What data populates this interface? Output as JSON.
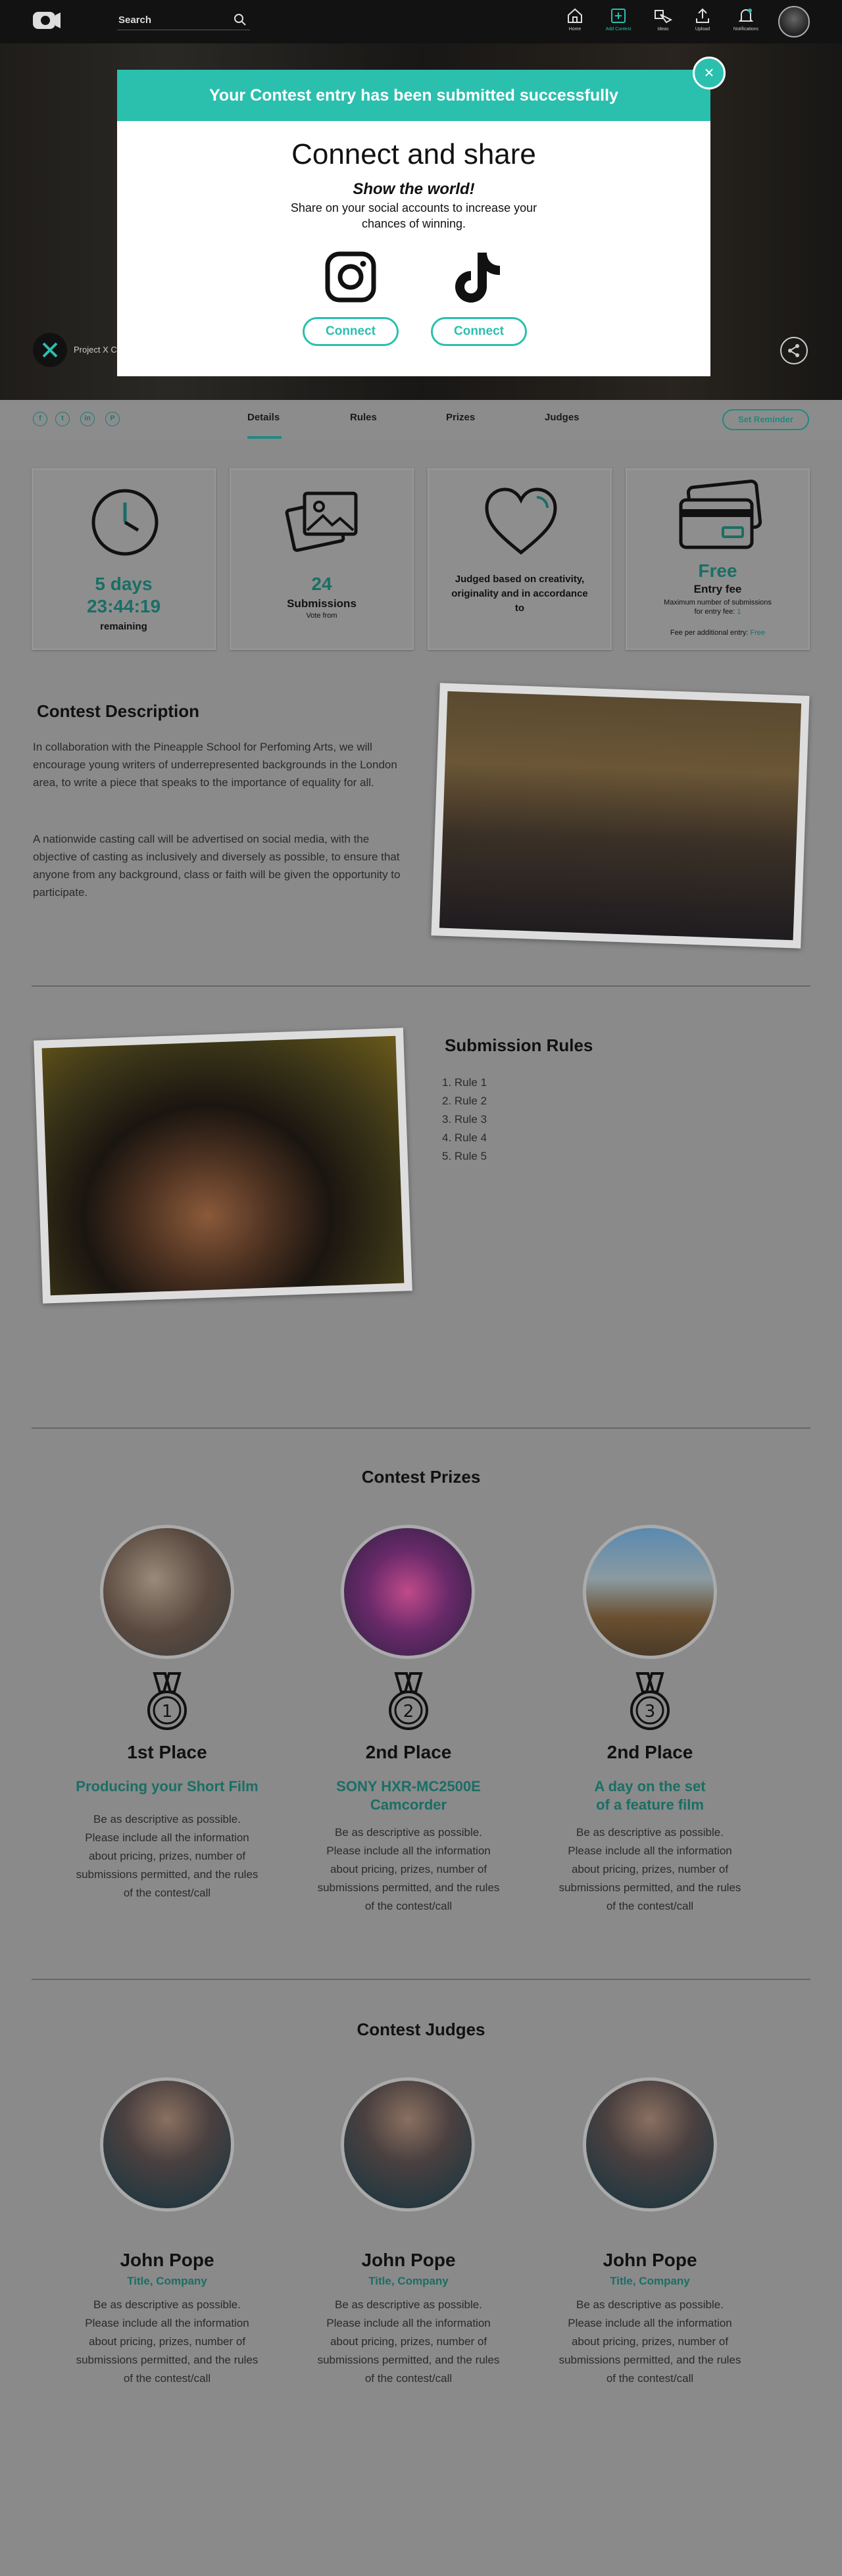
{
  "topbar": {
    "search_placeholder": "Search",
    "nav": [
      {
        "label": "Home",
        "icon": "home-icon"
      },
      {
        "label": "Add Contest",
        "icon": "add-contest-icon"
      },
      {
        "label": "Ideas",
        "icon": "ideas-icon"
      },
      {
        "label": "Upload",
        "icon": "upload-icon"
      },
      {
        "label": "Notifications",
        "icon": "bell-icon"
      }
    ]
  },
  "hero": {
    "caption": "Project X C"
  },
  "tabs": {
    "items": [
      "Details",
      "Rules",
      "Prizes",
      "Judges"
    ],
    "active": "Details",
    "reminder": "Set Reminder"
  },
  "social": [
    "f",
    "t",
    "in",
    "P"
  ],
  "stats": {
    "time": {
      "days": "5 days",
      "clock": "23:44:19",
      "label": "remaining"
    },
    "submissions": {
      "count": "24",
      "label": "Submissions",
      "sub": "Vote from"
    },
    "judged": {
      "text": "Judged based on creativity, originality and in accordance to"
    },
    "fee": {
      "value": "Free",
      "label": "Entry fee",
      "max_line1": "Maximum number of submissions",
      "max_line2": "for entry fee: ",
      "max_value": "1",
      "extra": "Fee per additional entry: ",
      "extra_value": "Free"
    }
  },
  "description": {
    "title": "Contest Description",
    "p1": "In collaboration with the Pineapple School for Perfoming Arts, we will encourage young writers of underrepresented backgrounds in the London area, to write a piece that speaks to the importance of equality for all.",
    "p2": "A nationwide casting call will be advertised on social media, with the objective of casting as inclusively and diversely as possible, to ensure that anyone from any background, class or faith will be given the opportunity to participate."
  },
  "rules": {
    "title": "Submission Rules",
    "items": [
      "Rule 1",
      "Rule 2",
      "Rule 3",
      "Rule 4",
      "Rule 5"
    ]
  },
  "prizes": {
    "title": "Contest Prizes",
    "items": [
      {
        "place": "1st Place",
        "medal": "1",
        "name_l1": "Producing your Short Film",
        "name_l2": "",
        "desc": "Be as descriptive as possible. Please include all the information about pricing, prizes, number of submissions permitted, and the rules of the contest/call"
      },
      {
        "place": "2nd Place",
        "medal": "2",
        "name_l1": "SONY HXR-MC2500E",
        "name_l2": "Camcorder",
        "desc": "Be as descriptive as possible. Please include all the information about pricing, prizes, number of submissions permitted, and the rules of the contest/call"
      },
      {
        "place": "2nd Place",
        "medal": "3",
        "name_l1": "A day on the set",
        "name_l2": "of a feature film",
        "desc": "Be as descriptive as possible. Please include all the information about pricing, prizes, number of submissions permitted, and the rules of the contest/call"
      }
    ]
  },
  "judges": {
    "title": "Contest Judges",
    "items": [
      {
        "name": "John Pope",
        "title": "Title, Company",
        "desc": "Be as descriptive as possible. Please include all the information about pricing, prizes, number of submissions permitted, and the rules of the contest/call"
      },
      {
        "name": "John Pope",
        "title": "Title, Company",
        "desc": "Be as descriptive as possible. Please include all the information about pricing, prizes, number of submissions permitted, and the rules of the contest/call"
      },
      {
        "name": "John Pope",
        "title": "Title, Company",
        "desc": "Be as descriptive as possible. Please include all the information about pricing, prizes, number of submissions permitted, and the rules of the contest/call"
      }
    ]
  },
  "modal": {
    "header": "Your Contest entry has been submitted successfully",
    "close": "×",
    "title": "Connect and share",
    "subtitle": "Show the world!",
    "text": "Share on your social accounts to increase your chances of winning.",
    "buttons": [
      "Connect",
      "Connect"
    ]
  },
  "colors": {
    "accent": "#2bbfae",
    "accent_dark": "#1a6e66",
    "topbar": "#121212"
  }
}
